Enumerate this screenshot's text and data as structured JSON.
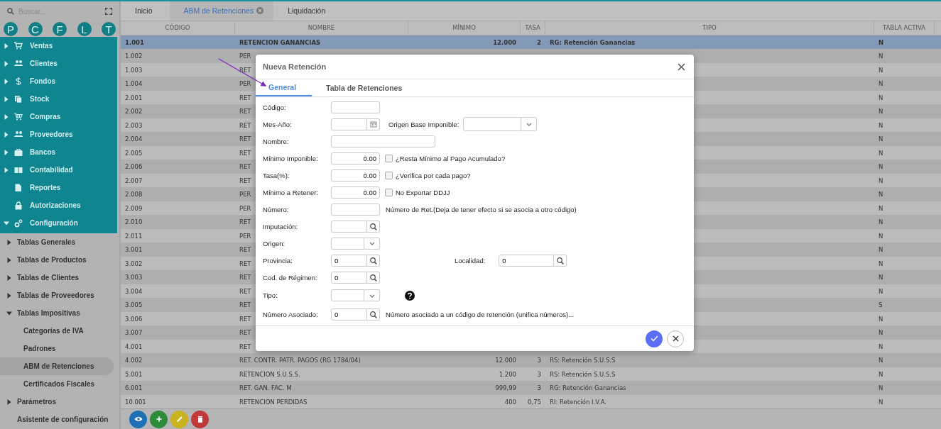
{
  "sidebar": {
    "search": {
      "placeholder": "Buscar..."
    },
    "shortcuts": [
      "P",
      "C",
      "F",
      "L",
      "T"
    ],
    "menu": [
      {
        "label": "Ventas",
        "kind": "group",
        "expanded": false
      },
      {
        "label": "Clientes",
        "kind": "group",
        "expanded": false
      },
      {
        "label": "Fondos",
        "kind": "group",
        "expanded": false
      },
      {
        "label": "Stock",
        "kind": "group",
        "expanded": false
      },
      {
        "label": "Compras",
        "kind": "group",
        "expanded": false
      },
      {
        "label": "Proveedores",
        "kind": "group",
        "expanded": false
      },
      {
        "label": "Bancos",
        "kind": "group",
        "expanded": false
      },
      {
        "label": "Contabilidad",
        "kind": "group",
        "expanded": false
      },
      {
        "label": "Reportes",
        "kind": "leaf"
      },
      {
        "label": "Autorizaciones",
        "kind": "leaf"
      },
      {
        "label": "Configuración",
        "kind": "group",
        "expanded": true,
        "children": [
          {
            "label": "Tablas Generales",
            "kind": "group",
            "expanded": false,
            "selected": false
          },
          {
            "label": "Tablas de Productos",
            "kind": "group",
            "expanded": false,
            "selected": false
          },
          {
            "label": "Tablas de Clientes",
            "kind": "group",
            "expanded": false,
            "selected": false
          },
          {
            "label": "Tablas de Proveedores",
            "kind": "group",
            "expanded": false,
            "selected": false
          },
          {
            "label": "Tablas Impositivas",
            "kind": "group",
            "expanded": true,
            "selected": false,
            "children": [
              {
                "label": "Categorías de IVA",
                "selected": false
              },
              {
                "label": "Padrones",
                "selected": false
              },
              {
                "label": "ABM de Retenciones",
                "selected": true
              },
              {
                "label": "Certificados Fiscales",
                "selected": false
              }
            ]
          },
          {
            "label": "Parámetros",
            "kind": "group",
            "expanded": false,
            "selected": false
          },
          {
            "label": "Asistente de configuración",
            "kind": "leaf",
            "selected": false
          }
        ]
      }
    ]
  },
  "tabs": [
    {
      "label": "Inicio",
      "selected": false,
      "closable": false
    },
    {
      "label": "ABM de Retenciones",
      "selected": true,
      "closable": true
    },
    {
      "label": "Liquidación",
      "selected": false,
      "closable": false
    }
  ],
  "table": {
    "columns": [
      "CÓDIGO",
      "NOMBRE",
      "MÍNIMO",
      "TASA",
      "TIPO",
      "TABLA ACTIVA"
    ],
    "rows": [
      {
        "codigo": "1.001",
        "nombre": "RETENCION GANANCIAS",
        "minimo": "12.000",
        "tasa": "2",
        "tipo": "RG: Retención Ganancias",
        "tabla_activa": "N",
        "selected": true
      },
      {
        "codigo": "1.002",
        "nombre": "PER",
        "tabla_activa": "N",
        "selected": false
      },
      {
        "codigo": "1.003",
        "nombre": "RET",
        "tabla_activa": "N",
        "selected": false
      },
      {
        "codigo": "1.004",
        "nombre": "PER",
        "tabla_activa": "N",
        "selected": false
      },
      {
        "codigo": "2.001",
        "nombre": "RET",
        "tabla_activa": "N",
        "selected": false
      },
      {
        "codigo": "2.002",
        "nombre": "RET",
        "tabla_activa": "N",
        "selected": false
      },
      {
        "codigo": "2.003",
        "nombre": "RET",
        "tabla_activa": "N",
        "selected": false
      },
      {
        "codigo": "2.004",
        "nombre": "RET",
        "tabla_activa": "N",
        "selected": false
      },
      {
        "codigo": "2.005",
        "nombre": "RET",
        "tabla_activa": "N",
        "selected": false
      },
      {
        "codigo": "2.006",
        "nombre": "RET",
        "tabla_activa": "N",
        "selected": false
      },
      {
        "codigo": "2.007",
        "nombre": "RET",
        "tabla_activa": "N",
        "selected": false
      },
      {
        "codigo": "2.008",
        "nombre": "PER",
        "tabla_activa": "N",
        "selected": false
      },
      {
        "codigo": "2.009",
        "nombre": "PER",
        "tabla_activa": "N",
        "selected": false
      },
      {
        "codigo": "2.010",
        "nombre": "RET",
        "tabla_activa": "N",
        "selected": false
      },
      {
        "codigo": "2.011",
        "nombre": "PER",
        "tabla_activa": "N",
        "selected": false
      },
      {
        "codigo": "3.001",
        "nombre": "RET",
        "tabla_activa": "N",
        "selected": false
      },
      {
        "codigo": "3.002",
        "nombre": "RET",
        "tabla_activa": "N",
        "selected": false
      },
      {
        "codigo": "3.003",
        "nombre": "RET",
        "tabla_activa": "N",
        "selected": false
      },
      {
        "codigo": "3.004",
        "nombre": "RET",
        "tabla_activa": "N",
        "selected": false
      },
      {
        "codigo": "3.005",
        "nombre": "RET",
        "tabla_activa": "S",
        "selected": false
      },
      {
        "codigo": "3.006",
        "nombre": "RET",
        "tabla_activa": "N",
        "selected": false
      },
      {
        "codigo": "3.007",
        "nombre": "RET",
        "tabla_activa": "N",
        "selected": false
      },
      {
        "codigo": "4.001",
        "nombre": "RET",
        "tabla_activa": "N",
        "selected": false
      },
      {
        "codigo": "4.002",
        "nombre": "RET. CONTR. PATR. PAGOS (RG 1784/04)",
        "minimo": "12.000",
        "tasa": "3",
        "tipo": "RS: Retención S.U.S.S",
        "tabla_activa": "N",
        "selected": false
      },
      {
        "codigo": "5.001",
        "nombre": "RETENCION S.U.S.S.",
        "minimo": "1.200",
        "tasa": "3",
        "tipo": "RS: Retención S.U.S.S",
        "tabla_activa": "N",
        "selected": false
      },
      {
        "codigo": "6.001",
        "nombre": "RET. GAN. FAC. M",
        "minimo": "999,99",
        "tasa": "3",
        "tipo": "RG: Retención Ganancias",
        "tabla_activa": "N",
        "selected": false
      },
      {
        "codigo": "10.001",
        "nombre": "RETENCION PERDIDAS",
        "minimo": "400",
        "tasa": "0,75",
        "tipo": "RI: Retención I.V.A.",
        "tabla_activa": "N",
        "selected": false
      }
    ]
  },
  "toolbar": [
    {
      "kind": "view"
    },
    {
      "kind": "add"
    },
    {
      "kind": "edit"
    },
    {
      "kind": "delete"
    }
  ],
  "dialog": {
    "title": "Nueva Retención",
    "tabs": [
      {
        "label": "General",
        "selected": true
      },
      {
        "label": "Tabla de Retenciones",
        "selected": false
      }
    ],
    "fields": [
      {
        "label": "Código:",
        "kind": "text"
      },
      {
        "label": "Mes-Año:",
        "kind": "date",
        "extra": {
          "kind": "select",
          "label": "Origen Base Imponible:"
        }
      },
      {
        "label": "Nombre:",
        "kind": "wide"
      },
      {
        "label": "Mínimo Imponible:",
        "kind": "number",
        "value": "0.00",
        "extra": {
          "kind": "checkbox",
          "label": "¿Resta Mínimo al Pago Acumulado?",
          "checked": false
        }
      },
      {
        "label": "Tasa(%):",
        "kind": "number",
        "value": "0.00",
        "extra": {
          "kind": "checkbox",
          "label": "¿Verifica por cada pago?",
          "checked": false
        }
      },
      {
        "label": "Mínimo a Retener:",
        "kind": "number",
        "value": "0.00",
        "extra": {
          "kind": "checkbox",
          "label": "No Exportar DDJJ",
          "checked": false
        }
      },
      {
        "label": "Número:",
        "kind": "text",
        "extra": {
          "kind": "note",
          "text": "Número de Ret.(Deja de tener efecto si se asocia a otro código)"
        }
      },
      {
        "label": "Imputación:",
        "kind": "lookup"
      },
      {
        "label": "Origen:",
        "kind": "select"
      },
      {
        "label": "Provincia:",
        "kind": "lookup",
        "value": "0",
        "extra": {
          "kind": "lookup",
          "label": "Localidad:",
          "value": "0"
        }
      },
      {
        "label": "Cod. de Régimen:",
        "kind": "lookup",
        "value": "0"
      },
      {
        "label": "Tipo:",
        "kind": "select",
        "extra": {
          "kind": "help"
        }
      },
      {
        "label": "Número Asociado:",
        "kind": "lookup",
        "value": "0",
        "extra": {
          "kind": "note",
          "text": "Número asociado a un código de retención (unifica números)..."
        }
      }
    ]
  }
}
